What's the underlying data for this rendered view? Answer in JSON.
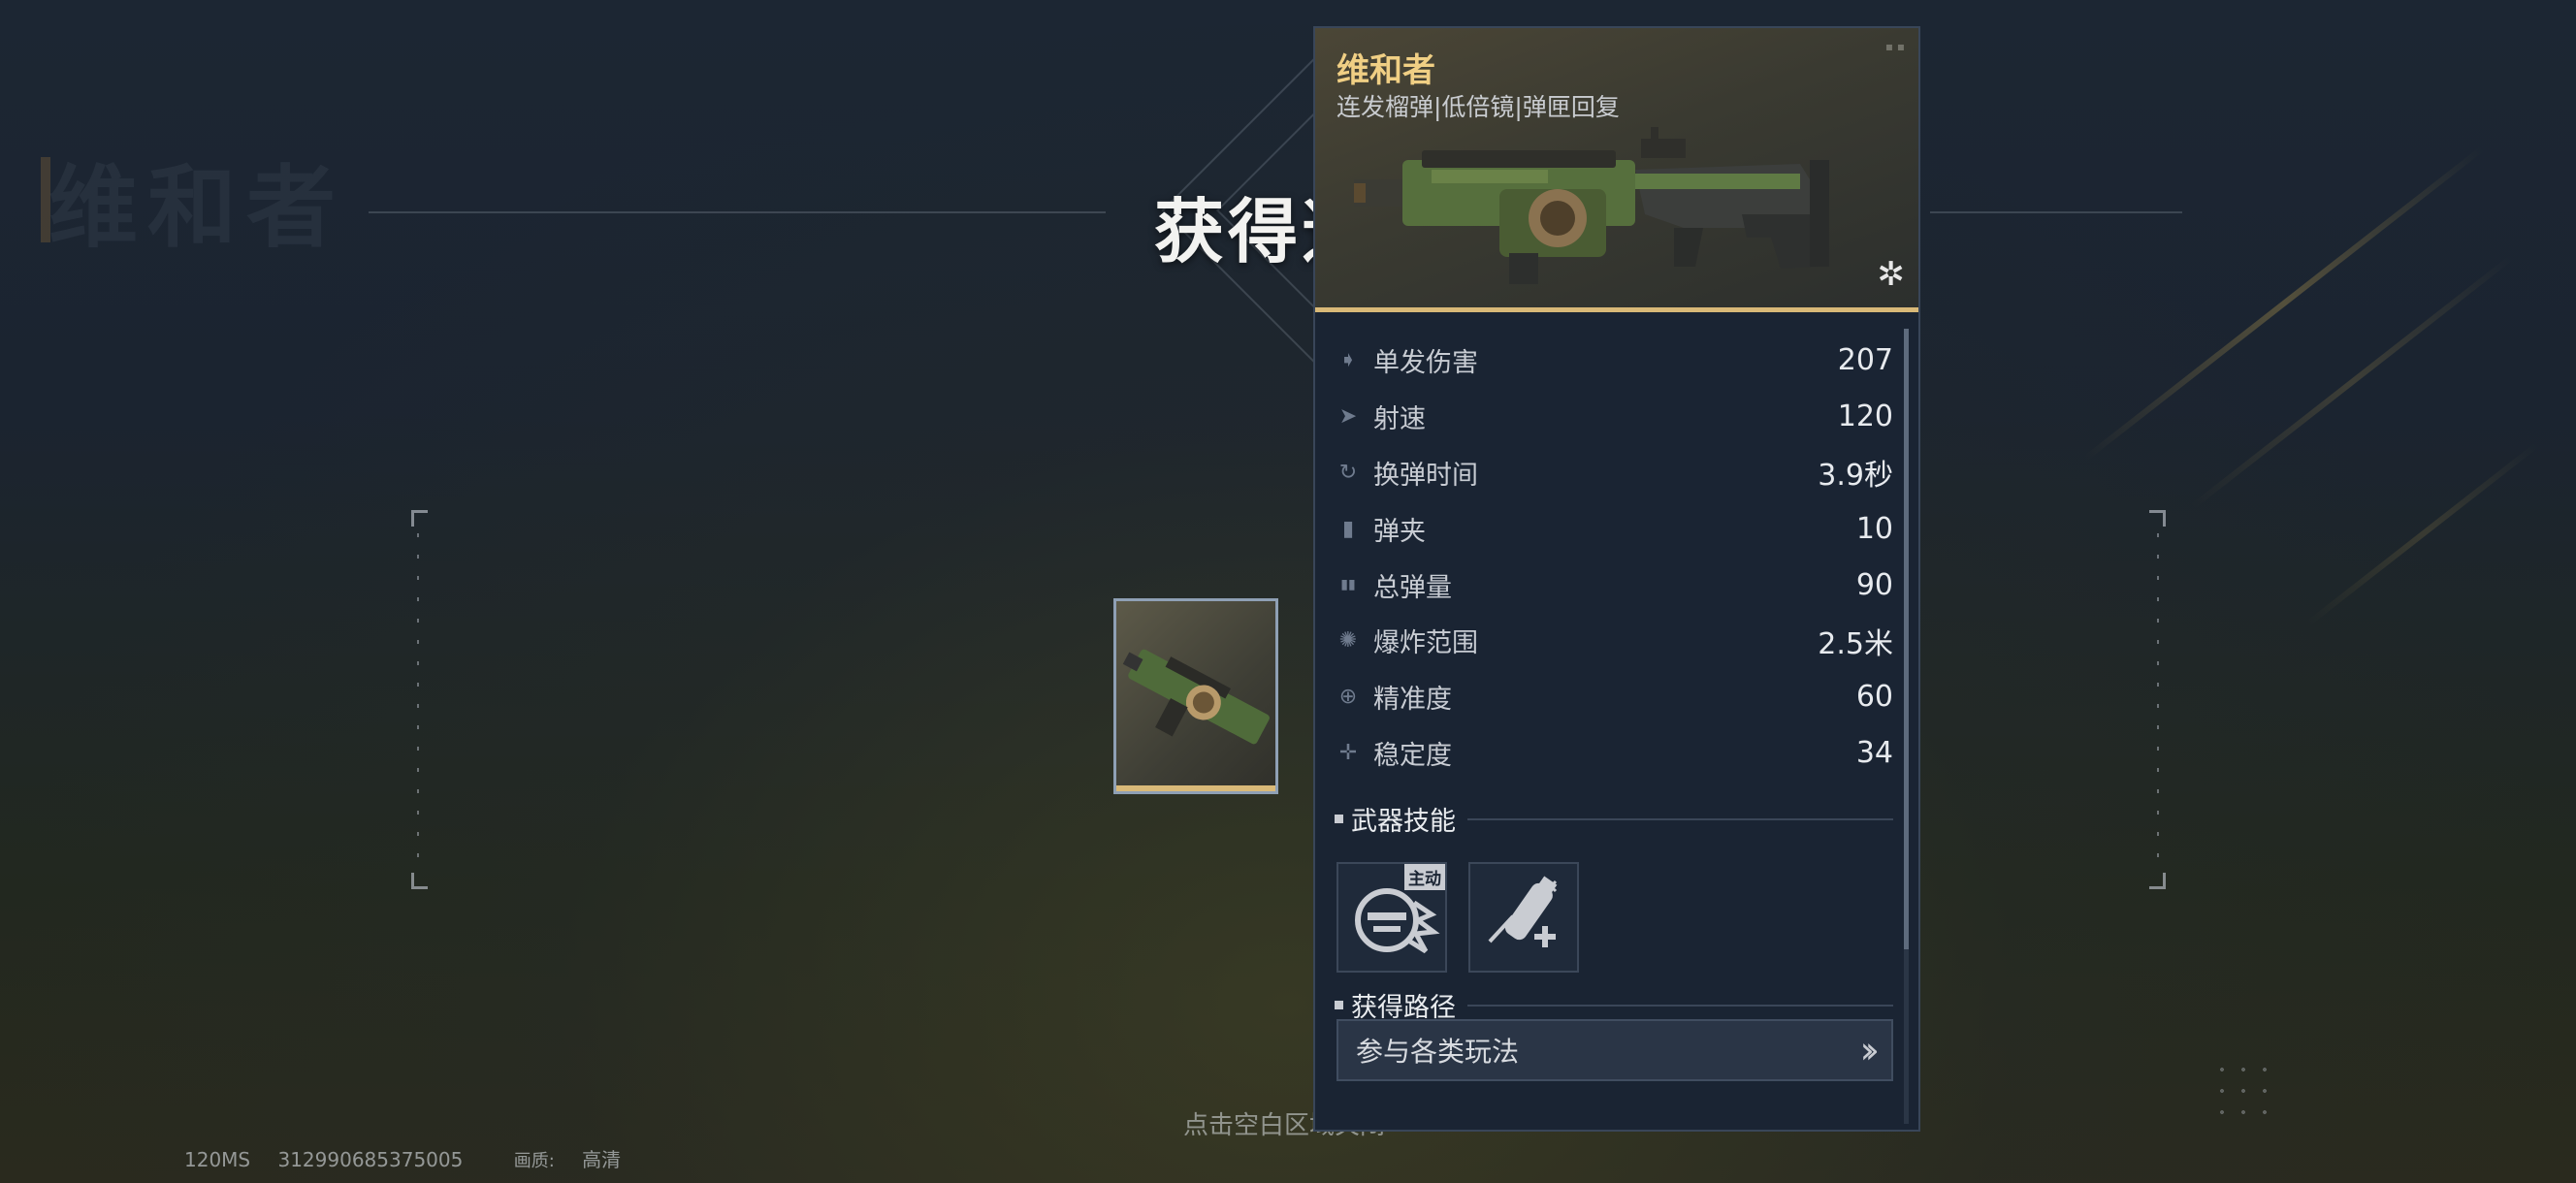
{
  "background": {
    "ghost_title": "维和者",
    "reward_title": "获得道具",
    "hint_text": "点击空白区域关闭",
    "status": {
      "latency": "120MS",
      "player_id": "312990685375005",
      "quality_label": "画质:",
      "quality_value": "高清"
    }
  },
  "panel": {
    "weapon_name": "维和者",
    "weapon_tags": "连发榴弹|低倍镜|弹匣回复",
    "rarity_icon": "star-badge-icon",
    "stats": [
      {
        "icon": "damage-icon",
        "glyph": "➧",
        "label": "单发伤害",
        "value": "207"
      },
      {
        "icon": "fire-rate-icon",
        "glyph": "➤",
        "label": "射速",
        "value": "120"
      },
      {
        "icon": "reload-icon",
        "glyph": "↻",
        "label": "换弹时间",
        "value": "3.9秒"
      },
      {
        "icon": "magazine-icon",
        "glyph": "▮",
        "label": "弹夹",
        "value": "10"
      },
      {
        "icon": "ammo-total-icon",
        "glyph": "▮▮",
        "label": "总弹量",
        "value": "90"
      },
      {
        "icon": "explosion-icon",
        "glyph": "✺",
        "label": "爆炸范围",
        "value": "2.5米"
      },
      {
        "icon": "accuracy-icon",
        "glyph": "⊕",
        "label": "精准度",
        "value": "60"
      },
      {
        "icon": "stability-icon",
        "glyph": "✛",
        "label": "稳定度",
        "value": "34"
      }
    ],
    "skills_section": "武器技能",
    "skills": [
      {
        "icon": "grenade-skill-icon",
        "tag": "主动"
      },
      {
        "icon": "magazine-restore-skill-icon",
        "tag": ""
      }
    ],
    "acquire_section": "获得路径",
    "acquire_button": "参与各类玩法",
    "acquire_arrow_icon": "double-chevron-right-icon"
  },
  "colors": {
    "accent_gold": "#d9b978",
    "title_gold": "#f0cf84",
    "panel_bg": "#1a2433"
  }
}
